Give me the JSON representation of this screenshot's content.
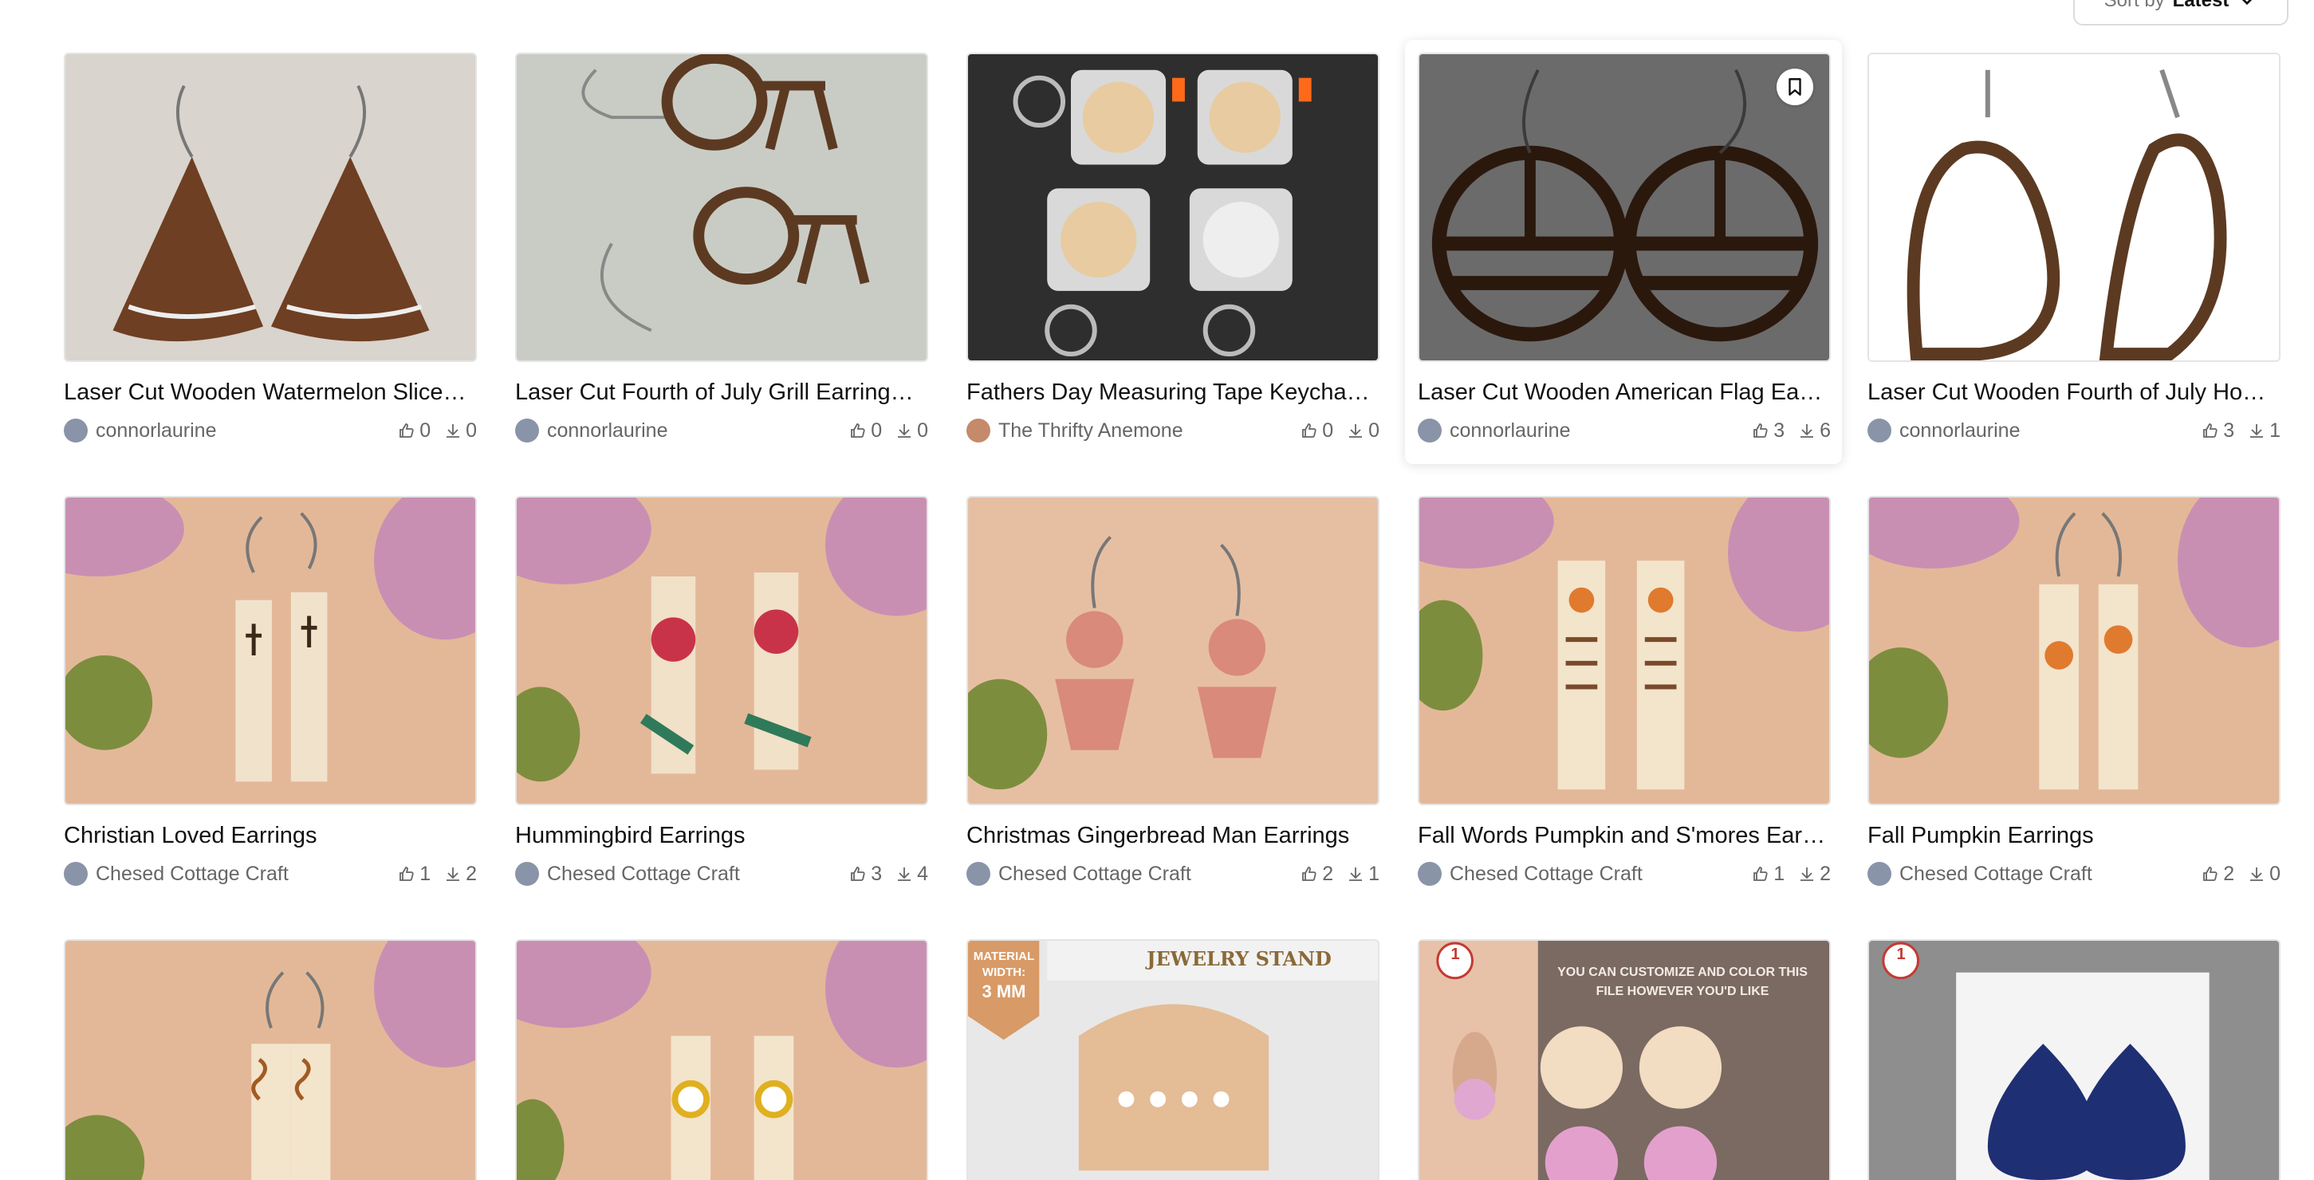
{
  "sort": {
    "label": "Sort by",
    "value": "Latest"
  },
  "cards": [
    {
      "title": "Laser Cut Wooden Watermelon Slice…",
      "author": "connorlaurine",
      "likes": "0",
      "downloads": "0",
      "avatar_color": "#8a94a8"
    },
    {
      "title": "Laser Cut Fourth of July Grill Earring…",
      "author": "connorlaurine",
      "likes": "0",
      "downloads": "0",
      "avatar_color": "#8a94a8"
    },
    {
      "title": "Fathers Day Measuring Tape Keycha…",
      "author": "The Thrifty Anemone",
      "likes": "0",
      "downloads": "0",
      "avatar_color": "#c58a6a"
    },
    {
      "title": "Laser Cut Wooden American Flag Ea…",
      "author": "connorlaurine",
      "likes": "3",
      "downloads": "6",
      "avatar_color": "#8a94a8"
    },
    {
      "title": "Laser Cut Wooden Fourth of July Ho…",
      "author": "connorlaurine",
      "likes": "3",
      "downloads": "1",
      "avatar_color": "#8a94a8"
    },
    {
      "title": "Christian Loved Earrings",
      "author": "Chesed Cottage Craft",
      "likes": "1",
      "downloads": "2",
      "avatar_color": "#8a94a8"
    },
    {
      "title": "Hummingbird Earrings",
      "author": "Chesed Cottage Craft",
      "likes": "3",
      "downloads": "4",
      "avatar_color": "#8a94a8"
    },
    {
      "title": "Christmas Gingerbread Man Earrings",
      "author": "Chesed Cottage Craft",
      "likes": "2",
      "downloads": "1",
      "avatar_color": "#8a94a8"
    },
    {
      "title": "Fall Words Pumpkin and S'mores Ear…",
      "author": "Chesed Cottage Craft",
      "likes": "1",
      "downloads": "2",
      "avatar_color": "#8a94a8"
    },
    {
      "title": "Fall Pumpkin Earrings",
      "author": "Chesed Cottage Craft",
      "likes": "2",
      "downloads": "0",
      "avatar_color": "#8a94a8"
    }
  ],
  "partial": {
    "jewelry_stand": {
      "heading": "JEWELRY STAND",
      "badge_line1": "MATERIAL",
      "badge_line2": "WIDTH:",
      "badge_line3": "3 MM"
    },
    "flower_text": "YOU CAN CUSTOMIZE AND COLOR THIS FILE HOWEVER YOU'D LIKE",
    "design_badge": "1"
  }
}
